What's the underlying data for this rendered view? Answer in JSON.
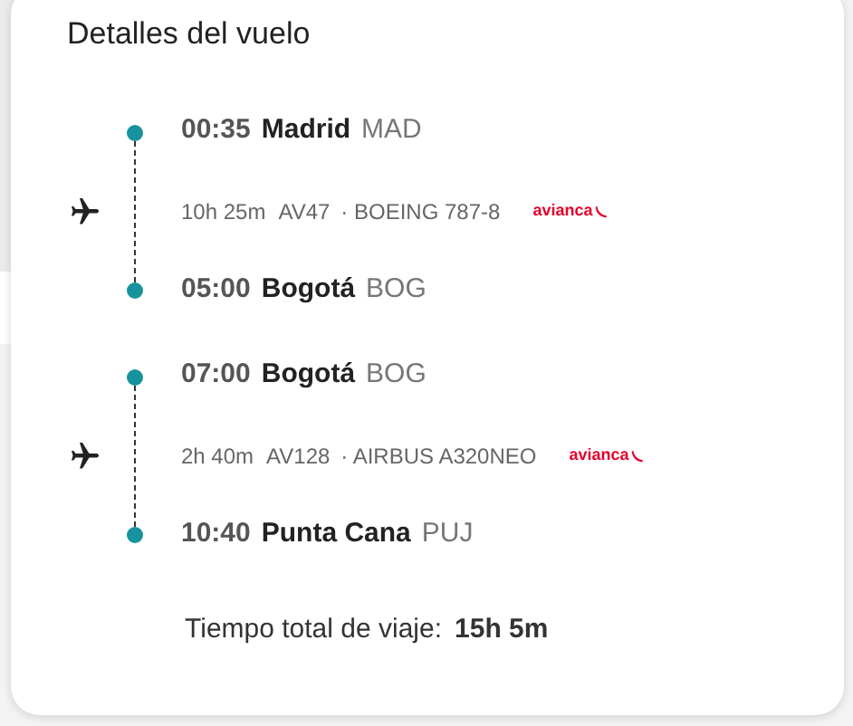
{
  "title": "Detalles del vuelo",
  "segments": [
    {
      "departure": {
        "time": "00:35",
        "city": "Madrid",
        "code": "MAD"
      },
      "duration": "10h 25m",
      "flight": "AV47",
      "aircraft": "· BOEING 787-8",
      "airline": "avianca",
      "arrival": {
        "time": "05:00",
        "city": "Bogotá",
        "code": "BOG"
      }
    },
    {
      "departure": {
        "time": "07:00",
        "city": "Bogotá",
        "code": "BOG"
      },
      "duration": "2h 40m",
      "flight": "AV128",
      "aircraft": "· AIRBUS A320NEO",
      "airline": "avianca",
      "arrival": {
        "time": "10:40",
        "city": "Punta Cana",
        "code": "PUJ"
      }
    }
  ],
  "total": {
    "label": "Tiempo total de viaje:",
    "value": "15h 5m"
  }
}
